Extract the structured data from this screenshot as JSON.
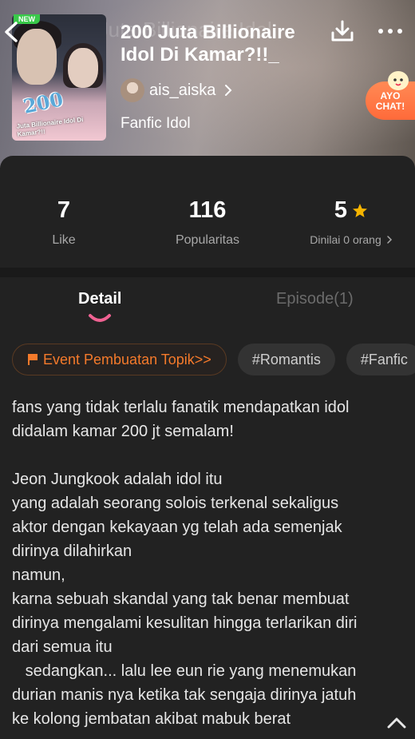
{
  "header": {
    "ghost_title": "200 Juta Billionaire Idol",
    "badge": "NEW",
    "cover_number": "200",
    "cover_subtitle": "Juta Billionaire Idol Di Kamar?!!",
    "title": "200 Juta Billionaire Idol Di Kamar?!!_",
    "author": "ais_aiska",
    "genre": "Fanfic Idol",
    "chat_label": "AYO CHAT!"
  },
  "stats": [
    {
      "value": "7",
      "label": "Like"
    },
    {
      "value": "116",
      "label": "Popularitas"
    },
    {
      "value": "5",
      "label": "Dinilai 0 orang"
    }
  ],
  "tabs": [
    {
      "label": "Detail",
      "active": true
    },
    {
      "label": "Episode(1)",
      "active": false
    }
  ],
  "tags": [
    "Event Pembuatan Topik>>",
    "#Romantis",
    "#Fanfic"
  ],
  "synopsis": "fans yang tidak terlalu fanatik mendapatkan idol\ndidalam kamar 200 jt semalam!\n\nJeon Jungkook adalah idol itu\nyang adalah seorang solois terkenal sekaligus\naktor dengan kekayaan yg telah ada semenjak\ndirinya dilahirkan\nnamun,\nkarna sebuah skandal yang tak benar membuat\ndirinya mengalami kesulitan hingga terlarikan diri\ndari semua itu\n   sedangkan... lalu lee eun rie yang menemukan\ndurian manis nya ketika tak sengaja dirinya jatuh\nke kolong jembatan akibat mabuk berat",
  "colors": {
    "background": "#222222",
    "accent_orange": "#f57a2b",
    "tab_indicator": "#f06292",
    "star": "#f5b400",
    "new_badge": "#39c94a"
  }
}
